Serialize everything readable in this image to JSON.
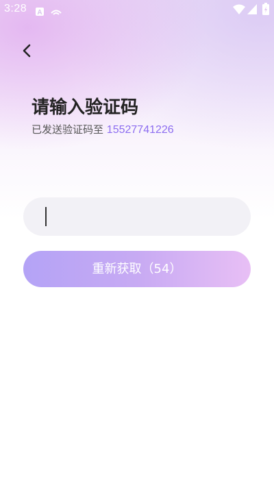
{
  "status_bar": {
    "time": "3:28",
    "icons": [
      "a-notification-icon",
      "cast-icon",
      "wifi-icon",
      "signal-icon",
      "battery-icon"
    ]
  },
  "header": {
    "back_icon": "chevron-left-icon"
  },
  "main": {
    "title": "请输入验证码",
    "subtitle_prefix": "已发送验证码至",
    "phone": "15527741226",
    "code_input": {
      "value": "",
      "placeholder": ""
    },
    "resend_button_label": "重新获取（54）"
  },
  "colors": {
    "accent": "#8c6cf0",
    "button_gradient_start": "#b4a3f6",
    "button_gradient_end": "#e8bff5",
    "input_background": "#f2f1f6"
  }
}
